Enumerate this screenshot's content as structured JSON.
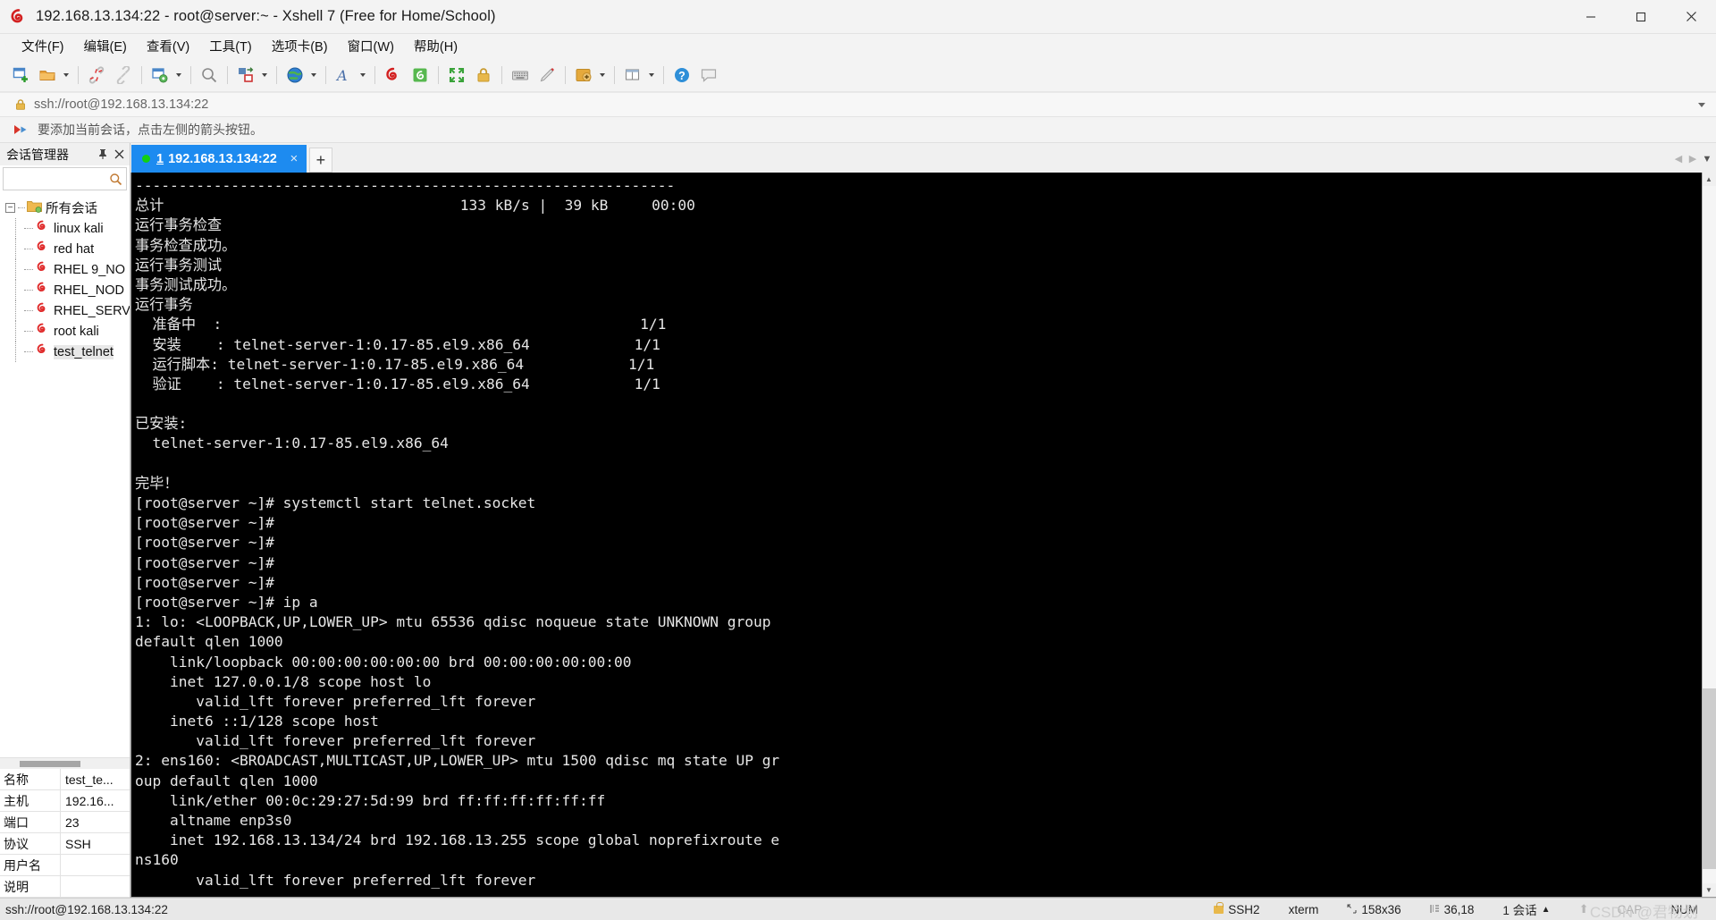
{
  "window": {
    "title": "192.168.13.134:22 - root@server:~ - Xshell 7 (Free for Home/School)",
    "app_icon": "xshell-spiral-icon",
    "minimize_label": "─",
    "maximize_label": "☐",
    "close_label": "✕"
  },
  "menubar": {
    "items": [
      {
        "label": "文件(F)",
        "name": "menu-file"
      },
      {
        "label": "编辑(E)",
        "name": "menu-edit"
      },
      {
        "label": "查看(V)",
        "name": "menu-view"
      },
      {
        "label": "工具(T)",
        "name": "menu-tools"
      },
      {
        "label": "选项卡(B)",
        "name": "menu-tabs"
      },
      {
        "label": "窗口(W)",
        "name": "menu-window"
      },
      {
        "label": "帮助(H)",
        "name": "menu-help"
      }
    ]
  },
  "toolbar": {
    "icons": [
      "new-session-icon",
      "open-folder-icon",
      "disconnect-icon",
      "link-icon",
      "session-properties-icon",
      "find-icon",
      "transfer-icon",
      "globe-icon",
      "font-icon",
      "xshell-icon",
      "xftp-icon",
      "fullscreen-icon",
      "lock-icon",
      "keyboard-icon",
      "compose-icon",
      "add-icon",
      "layout-icon",
      "help-icon",
      "comment-icon"
    ]
  },
  "address_bar": {
    "value": "ssh://root@192.168.13.134:22",
    "lock_icon": "lock-icon",
    "dropdown_icon": "chevron-down-icon"
  },
  "notice_bar": {
    "icon": "red-arrow-icon",
    "text": "要添加当前会话，点击左侧的箭头按钮。"
  },
  "sidebar": {
    "title": "会话管理器",
    "pin_icon": "pin-icon",
    "close_icon": "close-icon",
    "search": {
      "value": "",
      "placeholder": "",
      "icon": "search-icon"
    },
    "tree": {
      "root": {
        "label": "所有会话",
        "icon": "folder-sessions-icon",
        "expander": "−"
      },
      "items": [
        {
          "label": "linux kali",
          "icon": "session-icon",
          "selected": false
        },
        {
          "label": "red hat",
          "icon": "session-icon",
          "selected": false
        },
        {
          "label": "RHEL 9_NO",
          "icon": "session-icon",
          "selected": false
        },
        {
          "label": "RHEL_NOD",
          "icon": "session-icon",
          "selected": false
        },
        {
          "label": "RHEL_SERV",
          "icon": "session-icon",
          "selected": false
        },
        {
          "label": "root kali",
          "icon": "session-icon",
          "selected": false
        },
        {
          "label": "test_telnet",
          "icon": "session-icon",
          "selected": true
        }
      ]
    },
    "properties": [
      {
        "key": "名称",
        "value": "test_te..."
      },
      {
        "key": "主机",
        "value": "192.16..."
      },
      {
        "key": "端口",
        "value": "23"
      },
      {
        "key": "协议",
        "value": "SSH"
      },
      {
        "key": "用户名",
        "value": ""
      },
      {
        "key": "说明",
        "value": ""
      }
    ]
  },
  "tabs": {
    "items": [
      {
        "index": "1",
        "label": "192.168.13.134:22",
        "active": true,
        "status_color": "#12d012",
        "close_label": "×"
      }
    ],
    "new_tab_label": "+",
    "scroll_left": "◀",
    "scroll_right": "▶",
    "menu_caret": "▼"
  },
  "terminal": {
    "lines": [
      "--------------------------------------------------------------",
      "总计                                  133 kB/s |  39 kB     00:00",
      "运行事务检查",
      "事务检查成功。",
      "运行事务测试",
      "事务测试成功。",
      "运行事务",
      "  准备中  :                                                1/1 ",
      "  安装    : telnet-server-1:0.17-85.el9.x86_64            1/1 ",
      "  运行脚本: telnet-server-1:0.17-85.el9.x86_64            1/1 ",
      "  验证    : telnet-server-1:0.17-85.el9.x86_64            1/1 ",
      "",
      "已安装:",
      "  telnet-server-1:0.17-85.el9.x86_64",
      "",
      "完毕！",
      "[root@server ~]# systemctl start telnet.socket",
      "[root@server ~]#",
      "[root@server ~]#",
      "[root@server ~]#",
      "[root@server ~]#",
      "[root@server ~]# ip a",
      "1: lo: <LOOPBACK,UP,LOWER_UP> mtu 65536 qdisc noqueue state UNKNOWN group",
      "default qlen 1000",
      "    link/loopback 00:00:00:00:00:00 brd 00:00:00:00:00:00",
      "    inet 127.0.0.1/8 scope host lo",
      "       valid_lft forever preferred_lft forever",
      "    inet6 ::1/128 scope host",
      "       valid_lft forever preferred_lft forever",
      "2: ens160: <BROADCAST,MULTICAST,UP,LOWER_UP> mtu 1500 qdisc mq state UP gr",
      "oup default qlen 1000",
      "    link/ether 00:0c:29:27:5d:99 brd ff:ff:ff:ff:ff:ff",
      "    altname enp3s0",
      "    inet 192.168.13.134/24 brd 192.168.13.255 scope global noprefixroute e",
      "ns160",
      "       valid_lft forever preferred_lft forever"
    ]
  },
  "statusbar": {
    "left": "ssh://root@192.168.13.134:22",
    "protocol": "SSH2",
    "protocol_icon": "lock-icon",
    "term_type": "xterm",
    "size": "158x36",
    "size_icon": "resize-icon",
    "cursor": "36,18",
    "cursor_icon": "cursor-icon",
    "sessions": "1 会话",
    "sessions_caret": "▲",
    "upload_icon": "upload-arrow-icon",
    "caps": "CAP",
    "num": "NUM",
    "watermark": "CSDN @君物划"
  }
}
